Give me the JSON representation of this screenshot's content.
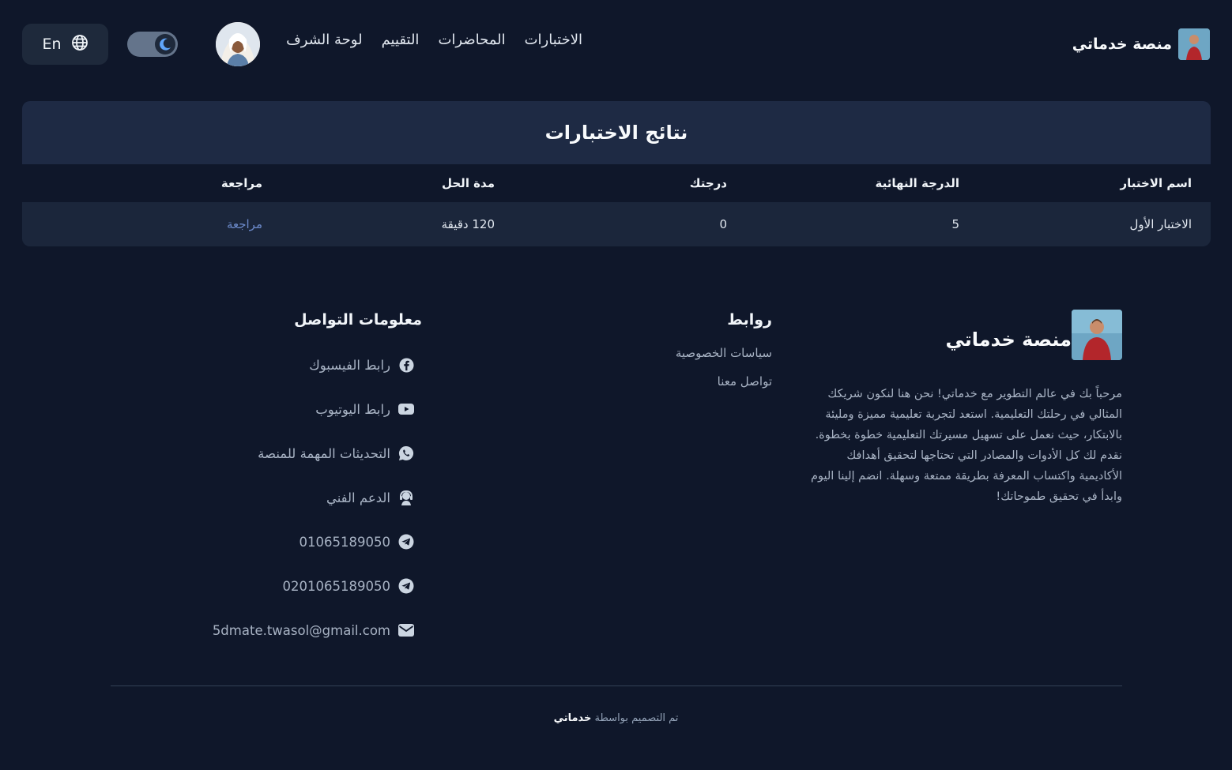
{
  "header": {
    "brand_name": "منصة خدماتي",
    "nav": [
      {
        "label": "الاختبارات"
      },
      {
        "label": "المحاضرات"
      },
      {
        "label": "التقييم"
      },
      {
        "label": "لوحة الشرف"
      }
    ],
    "language_label": "En",
    "theme": "dark"
  },
  "results": {
    "title": "نتائج الاختبارات",
    "columns": [
      "اسم الاختبار",
      "الدرجة النهائية",
      "درجتك",
      "مدة الحل",
      "مراجعة"
    ],
    "rows": [
      {
        "name": "الاختبار الأول",
        "max_score": "5",
        "your_score": "0",
        "duration": "120 دقيقة",
        "review": "مراجعة"
      }
    ]
  },
  "footer": {
    "brand_name": "منصة خدماتي",
    "about": "مرحباً بك في عالم التطوير مع خدماتي! نحن هنا لنكون شريكك المثالي في رحلتك التعليمية. استعد لتجربة تعليمية مميزة ومليئة بالابتكار، حيث نعمل على تسهيل مسيرتك التعليمية خطوة بخطوة. نقدم لك كل الأدوات والمصادر التي تحتاجها لتحقيق أهدافك الأكاديمية واكتساب المعرفة بطريقة ممتعة وسهلة. انضم إلينا اليوم وابدأ في تحقيق طموحاتك!",
    "links_title": "روابط",
    "links": [
      {
        "label": "سياسات الخصوصية"
      },
      {
        "label": "تواصل معنا"
      }
    ],
    "contact_title": "معلومات التواصل",
    "contacts": [
      {
        "icon": "facebook-icon",
        "label": "رابط الفيسبوك"
      },
      {
        "icon": "youtube-icon",
        "label": "رابط اليوتيوب"
      },
      {
        "icon": "whatsapp-icon",
        "label": "التحديثات المهمة للمنصة"
      },
      {
        "icon": "support-icon",
        "label": "الدعم الفني"
      },
      {
        "icon": "telegram-icon",
        "label": "01065189050"
      },
      {
        "icon": "telegram-icon",
        "label": "0201065189050"
      },
      {
        "icon": "mail-icon",
        "label": "5dmate.twasol@gmail.com"
      }
    ],
    "credit_prefix": "تم التصميم بواسطة",
    "credit_name": "خدماتي"
  },
  "colors": {
    "background": "#0f172a",
    "card_header": "#1e2a44",
    "link_accent": "#6b89c9",
    "toggle_moon": "#60a5fa"
  }
}
